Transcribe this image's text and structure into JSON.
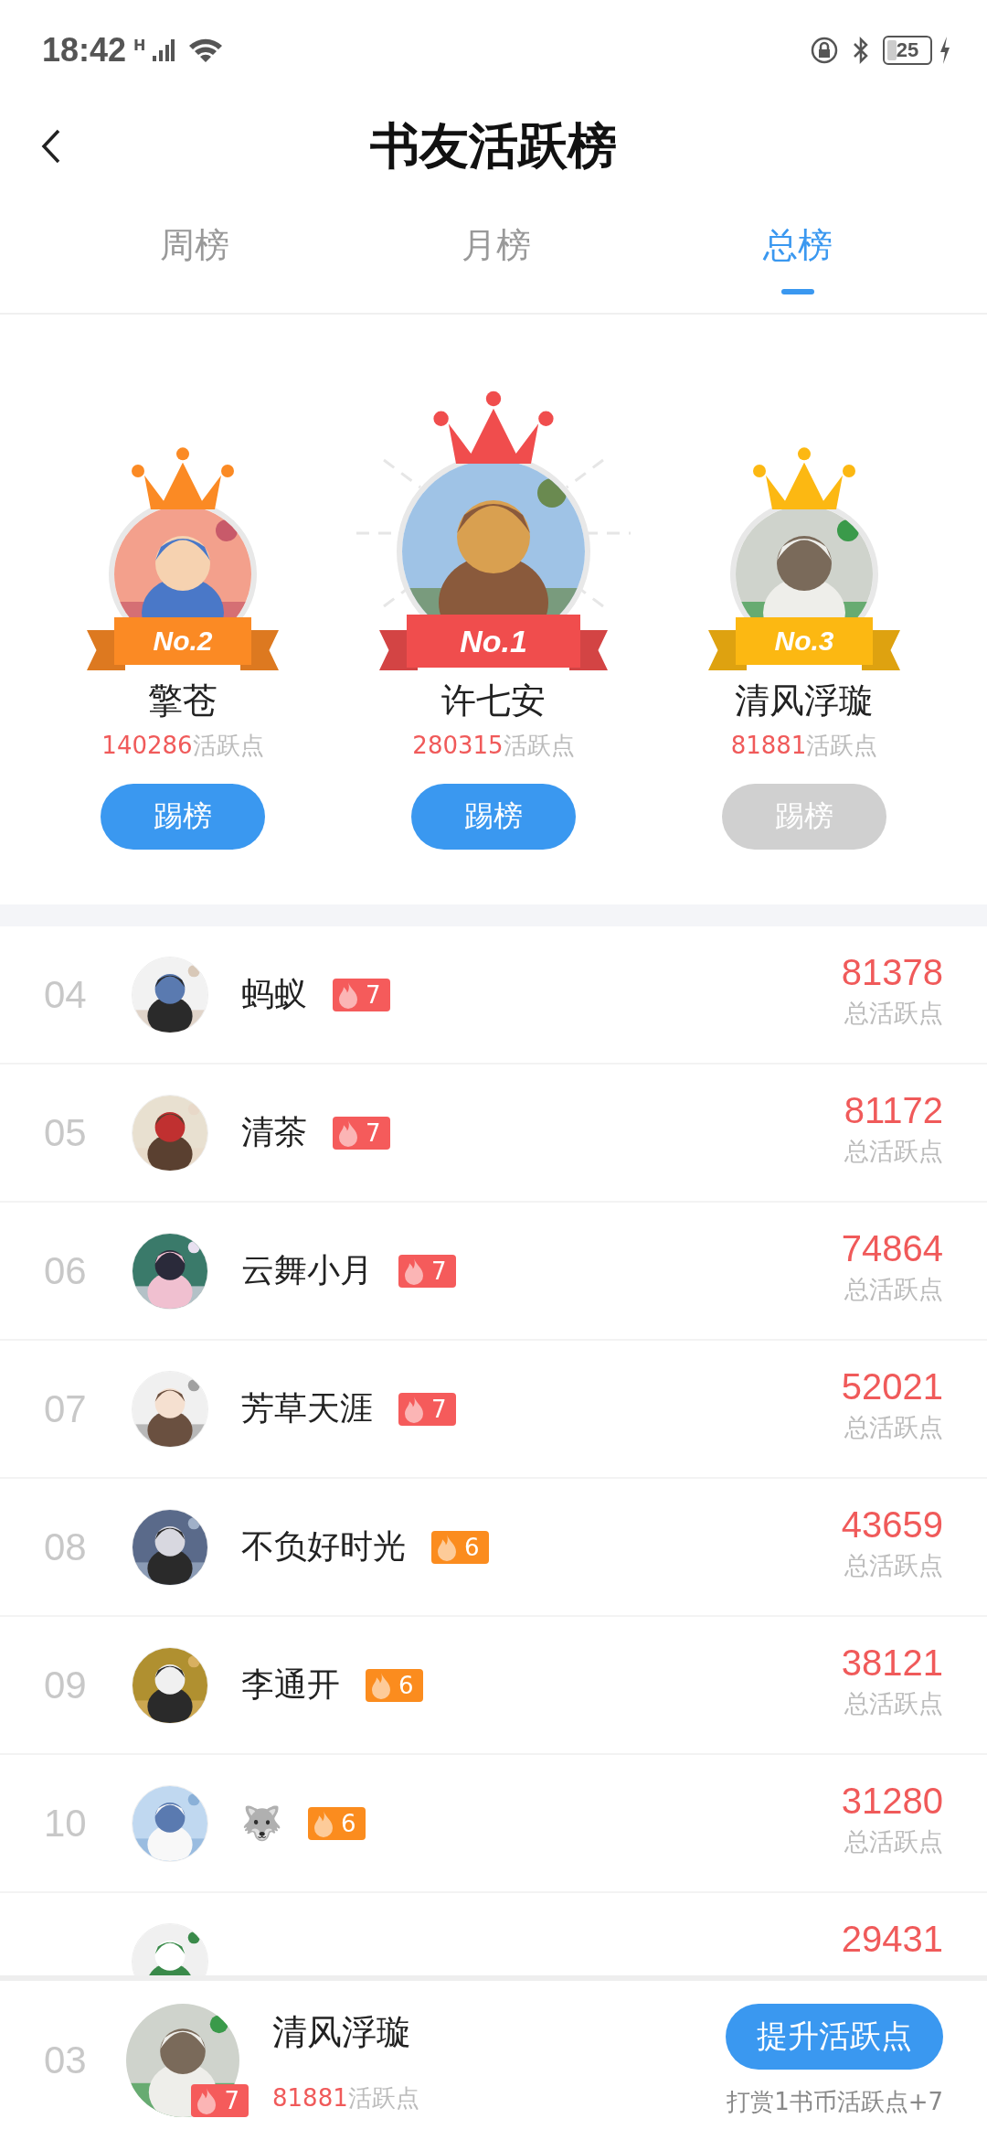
{
  "status_bar": {
    "time": "18:42",
    "network": "H",
    "battery": "25"
  },
  "header": {
    "title": "书友活跃榜"
  },
  "tabs": [
    {
      "label": "周榜",
      "selected": false
    },
    {
      "label": "月榜",
      "selected": false
    },
    {
      "label": "总榜",
      "selected": true
    }
  ],
  "podium": [
    {
      "rank_label": "No.2",
      "color": "#fb8a24",
      "featured": false,
      "name": "擎苍",
      "score": "140286",
      "unit": "活跃点",
      "button": "踢榜",
      "disabled": false
    },
    {
      "rank_label": "No.1",
      "color": "#f04d4d",
      "featured": true,
      "name": "许七安",
      "score": "280315",
      "unit": "活跃点",
      "button": "踢榜",
      "disabled": false
    },
    {
      "rank_label": "No.3",
      "color": "#fcb812",
      "featured": false,
      "name": "清风浮璇",
      "score": "81881",
      "unit": "活跃点",
      "button": "踢榜",
      "disabled": true
    }
  ],
  "rows": [
    {
      "rank": "04",
      "name": "蚂蚁",
      "level": "7",
      "color": "#f55b5b",
      "score": "81378",
      "unit": "总活跃点"
    },
    {
      "rank": "05",
      "name": "清茶",
      "level": "7",
      "color": "#f55b5b",
      "score": "81172",
      "unit": "总活跃点"
    },
    {
      "rank": "06",
      "name": "云舞小月",
      "level": "7",
      "color": "#f55b5b",
      "score": "74864",
      "unit": "总活跃点"
    },
    {
      "rank": "07",
      "name": "芳草天涯",
      "level": "7",
      "color": "#f55b5b",
      "score": "52021",
      "unit": "总活跃点"
    },
    {
      "rank": "08",
      "name": "不负好时光",
      "level": "6",
      "color": "#fb8c1e",
      "score": "43659",
      "unit": "总活跃点"
    },
    {
      "rank": "09",
      "name": "李通开",
      "level": "6",
      "color": "#fb8c1e",
      "score": "38121",
      "unit": "总活跃点"
    },
    {
      "rank": "10",
      "name": "🐺",
      "level": "6",
      "color": "#fb8c1e",
      "score": "31280",
      "unit": "总活跃点"
    },
    {
      "score": "29431"
    }
  ],
  "me": {
    "rank": "03",
    "name": "清风浮璇",
    "level": "7",
    "score": "81881",
    "unit": "活跃点",
    "button": "提升活跃点",
    "hint": "打赏1书币活跃点+7"
  }
}
